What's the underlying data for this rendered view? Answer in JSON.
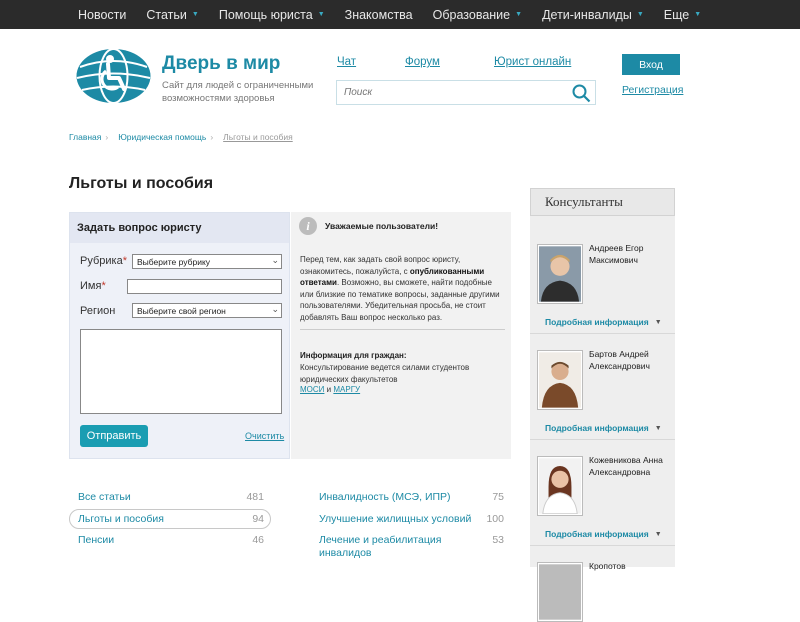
{
  "nav": [
    {
      "label": "Новости",
      "dropdown": false
    },
    {
      "label": "Статьи",
      "dropdown": true
    },
    {
      "label": "Помощь юриста",
      "dropdown": true
    },
    {
      "label": "Знакомства",
      "dropdown": false
    },
    {
      "label": "Образование",
      "dropdown": true
    },
    {
      "label": "Дети-инвалиды",
      "dropdown": true
    },
    {
      "label": "Еще",
      "dropdown": true
    }
  ],
  "header": {
    "brand": "Дверь в мир",
    "tagline": "Сайт для людей с ограниченными возможностями здоровья",
    "links": {
      "chat": "Чат",
      "forum": "Форум",
      "lawyer": "Юрист онлайн"
    },
    "search_placeholder": "Поиск",
    "login": "Вход",
    "register": "Регистрация"
  },
  "breadcrumb": {
    "home": "Главная",
    "section": "Юридическая помощь",
    "current": "Льготы и пособия"
  },
  "page_title": "Льготы и пособия",
  "form": {
    "title": "Задать вопрос юристу",
    "rubric_label": "Рубрика",
    "rubric_value": "Выберите рубрику",
    "name_label": "Имя",
    "region_label": "Регион",
    "region_value": "Выберите свой регион",
    "submit": "Отправить",
    "clear": "Очистить"
  },
  "notice": {
    "title": "Уважаемые пользователи!",
    "text_1": "Перед тем, как задать свой вопрос юристу, ознакомитесь, пожалуйста, с",
    "text_bold": "опубликованными ответами",
    "text_2": ". Возможно, вы сможете, найти подобные или близкие по тематике вопросы, заданные другими пользователями. Убедительная просьба, не стоит добавлять Ваш вопрос несколько раз.",
    "citizens_title": "Информация для граждан:",
    "citizens_text": "Консультирование ведется силами студентов юридических факультетов",
    "link_mosi": "МОСИ",
    "link_and": "и",
    "link_margu": "МАРГУ"
  },
  "categories_left": [
    {
      "label": "Все статьи",
      "count": "481"
    },
    {
      "label": "Льготы и пособия",
      "count": "94"
    },
    {
      "label": "Пенсии",
      "count": "46"
    }
  ],
  "categories_right": [
    {
      "label": "Инвалидность (МСЭ, ИПР)",
      "count": "75"
    },
    {
      "label": "Улучшение жилищных условий",
      "count": "100"
    },
    {
      "label": "Лечение и реабилитация инвалидов",
      "count": "53"
    }
  ],
  "consultants": {
    "title": "Консультанты",
    "more_label": "Подробная информация",
    "people": [
      {
        "name": "Андреев Егор Максимович"
      },
      {
        "name": "Бартов Андрей Александрович"
      },
      {
        "name": "Кожевникова Анна Александровна"
      },
      {
        "name": "Кропотов"
      }
    ]
  },
  "colors": {
    "accent": "#1d8aa5",
    "button": "#1a9db2",
    "nav_bg": "#2b2b2b"
  }
}
